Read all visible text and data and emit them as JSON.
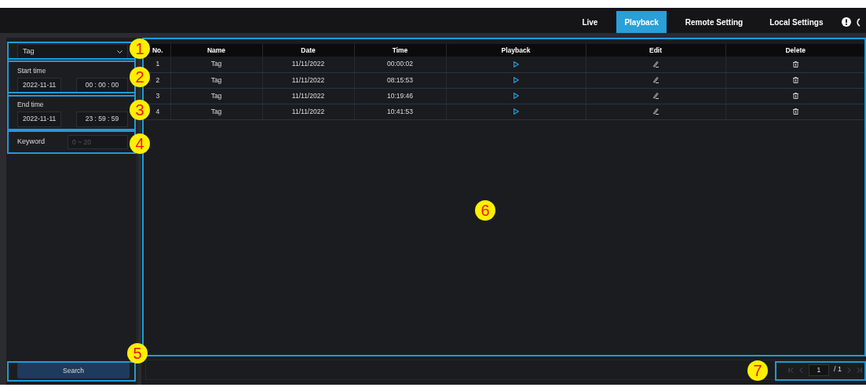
{
  "header": {
    "tabs": [
      {
        "label": "Live",
        "selected": false
      },
      {
        "label": "Playback",
        "selected": true
      },
      {
        "label": "Remote Setting",
        "selected": false
      },
      {
        "label": "Local Settings",
        "selected": false
      }
    ]
  },
  "filters": {
    "type_select": {
      "value": "Tag"
    },
    "start_time": {
      "label": "Start time",
      "date": "2022-11-11",
      "hh": "00",
      "mm": "00",
      "ss": "00",
      "separator": ":"
    },
    "end_time": {
      "label": "End time",
      "date": "2022-11-11",
      "hh": "23",
      "mm": "59",
      "ss": "59",
      "separator": ":"
    },
    "keyword": {
      "label": "Keyword",
      "placeholder": "0 ~ 20"
    },
    "search_button": "Search"
  },
  "table": {
    "columns": [
      "No.",
      "Name",
      "Date",
      "Time",
      "Playback",
      "Edit",
      "Delete"
    ],
    "rows": [
      {
        "no": "1",
        "name": "Tag",
        "date": "11/11/2022",
        "time": "00:00:02"
      },
      {
        "no": "2",
        "name": "Tag",
        "date": "11/11/2022",
        "time": "08:15:53"
      },
      {
        "no": "3",
        "name": "Tag",
        "date": "11/11/2022",
        "time": "10:19:46"
      },
      {
        "no": "4",
        "name": "Tag",
        "date": "11/11/2022",
        "time": "10:41:53"
      }
    ]
  },
  "pagination": {
    "page": "1",
    "total": "/ 1"
  },
  "callouts": [
    "1",
    "2",
    "3",
    "4",
    "5",
    "6",
    "7"
  ]
}
